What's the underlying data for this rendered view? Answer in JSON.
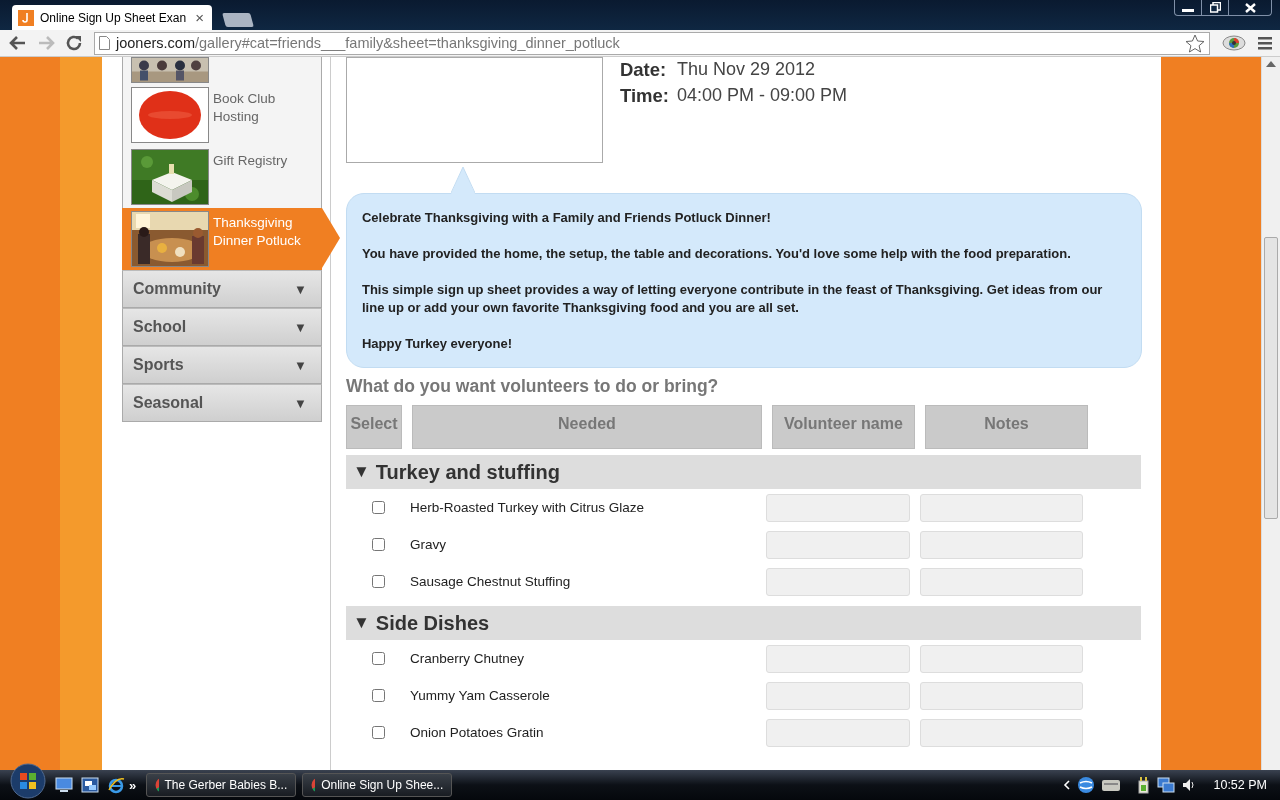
{
  "browser": {
    "tab_title": "Online Sign Up Sheet Exan",
    "tab_close": "×",
    "url_domain": "jooners.com",
    "url_path": "/gallery#cat=friends___family&sheet=thanksgiving_dinner_potluck"
  },
  "sidebar": {
    "items": [
      {
        "selected": false
      },
      {
        "label": "Book Club Hosting",
        "selected": false
      },
      {
        "label": "Gift Registry",
        "selected": false
      },
      {
        "label": "Thanksgiving Dinner Potluck",
        "selected": true
      }
    ],
    "categories": [
      {
        "label": "Community",
        "toggle": "▼"
      },
      {
        "label": "School",
        "toggle": "▼"
      },
      {
        "label": "Sports",
        "toggle": "▼"
      },
      {
        "label": "Seasonal",
        "toggle": "▼"
      }
    ]
  },
  "event": {
    "date_label": "Date:",
    "date": "Thu Nov 29 2012",
    "time_label": "Time:",
    "time": "04:00 PM - 09:00 PM"
  },
  "description": [
    "Celebrate Thanksgiving with a Family and Friends Potluck Dinner!",
    "You have provided the home, the setup, the table and decorations. You'd love some help with the food preparation.",
    "This simple sign up sheet provides a way of letting everyone contribute in the feast of Thanksgiving. Get ideas from our line up or add your own favorite Thanksgiving food and you are all set.",
    "Happy Turkey everyone!"
  ],
  "question": "What do you want volunteers to do or bring?",
  "columns": [
    "Select",
    "Needed",
    "Volunteer name",
    "Notes"
  ],
  "sections": [
    {
      "toggle": "▼",
      "title": "Turkey and stuffing",
      "items": [
        {
          "name": "Herb-Roasted Turkey with Citrus Glaze",
          "checked": false
        },
        {
          "name": "Gravy",
          "checked": false
        },
        {
          "name": "Sausage Chestnut Stuffing",
          "checked": false
        }
      ]
    },
    {
      "toggle": "▼",
      "title": "Side Dishes",
      "items": [
        {
          "name": "Cranberry Chutney",
          "checked": false
        },
        {
          "name": "Yummy Yam Casserole",
          "checked": false
        },
        {
          "name": "Onion Potatoes Gratin",
          "checked": false
        }
      ]
    }
  ],
  "taskbar": {
    "tasks": [
      {
        "label": "The Gerber Babies B..."
      },
      {
        "label": "Online Sign Up Shee..."
      }
    ],
    "more": "»",
    "clock": "10:52 PM"
  }
}
